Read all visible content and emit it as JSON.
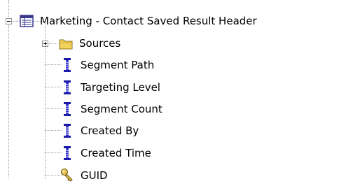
{
  "tree": {
    "root": {
      "label": "Marketing - Contact Saved Result Header",
      "icon": "table-icon",
      "expanded": true
    },
    "children": [
      {
        "label": "Sources",
        "icon": "folder-icon",
        "expandable": true
      },
      {
        "label": "Segment Path",
        "icon": "column-icon"
      },
      {
        "label": "Targeting Level",
        "icon": "column-icon"
      },
      {
        "label": "Segment Count",
        "icon": "column-icon"
      },
      {
        "label": "Created By",
        "icon": "column-icon"
      },
      {
        "label": "Created Time",
        "icon": "column-icon"
      },
      {
        "label": "GUID",
        "icon": "key-icon"
      }
    ]
  },
  "colors": {
    "tree_lines": "#a0a0a0",
    "column_icon_blue": "#1b1ba8",
    "folder_yellow": "#f2d35c",
    "key_yellow": "#e6c24a"
  }
}
